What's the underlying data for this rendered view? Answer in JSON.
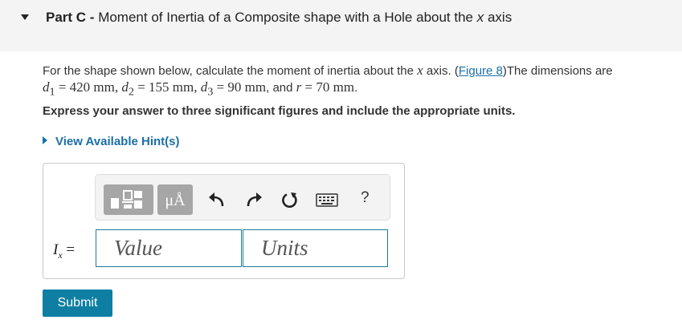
{
  "part": {
    "label": "Part C",
    "separator": " - ",
    "title_main": "Moment of Inertia of a Composite shape with a Hole about the ",
    "title_var": "x",
    "title_end": " axis"
  },
  "prompt": {
    "text1": "For the shape shown below, calculate the  moment of inertia about the ",
    "axis_var": "x",
    "text2": " axis. (",
    "figure_link": "Figure 8",
    "text3": ")The dimensions are",
    "d1": "d",
    "d1_sub": "1",
    "d1_val": " = 420 mm, ",
    "d2": "d",
    "d2_sub": "2",
    "d2_val": " = 155 mm, ",
    "d3": "d",
    "d3_sub": "3",
    "d3_val": " = 90 mm",
    "and_text": ", and ",
    "r": "r",
    "r_val": " = 70 mm",
    "end": "."
  },
  "instruction": "Express your answer to three significant figures and include the appropriate units.",
  "hint": {
    "label": "View Available Hint(s)"
  },
  "answer": {
    "var": "I",
    "var_sub": "x",
    "equals": " =",
    "value_placeholder": "Value",
    "units_placeholder": "Units"
  },
  "toolbar": {
    "units_symbol": "μÅ",
    "help": "?",
    "icons": [
      "templates-icon",
      "units-icon",
      "undo-icon",
      "redo-icon",
      "reset-icon",
      "keyboard-icon",
      "help-icon"
    ]
  },
  "submit_label": "Submit",
  "colors": {
    "link": "#1a6fa8",
    "button": "#0e7fa3",
    "header_bg": "#f4f4f4"
  }
}
